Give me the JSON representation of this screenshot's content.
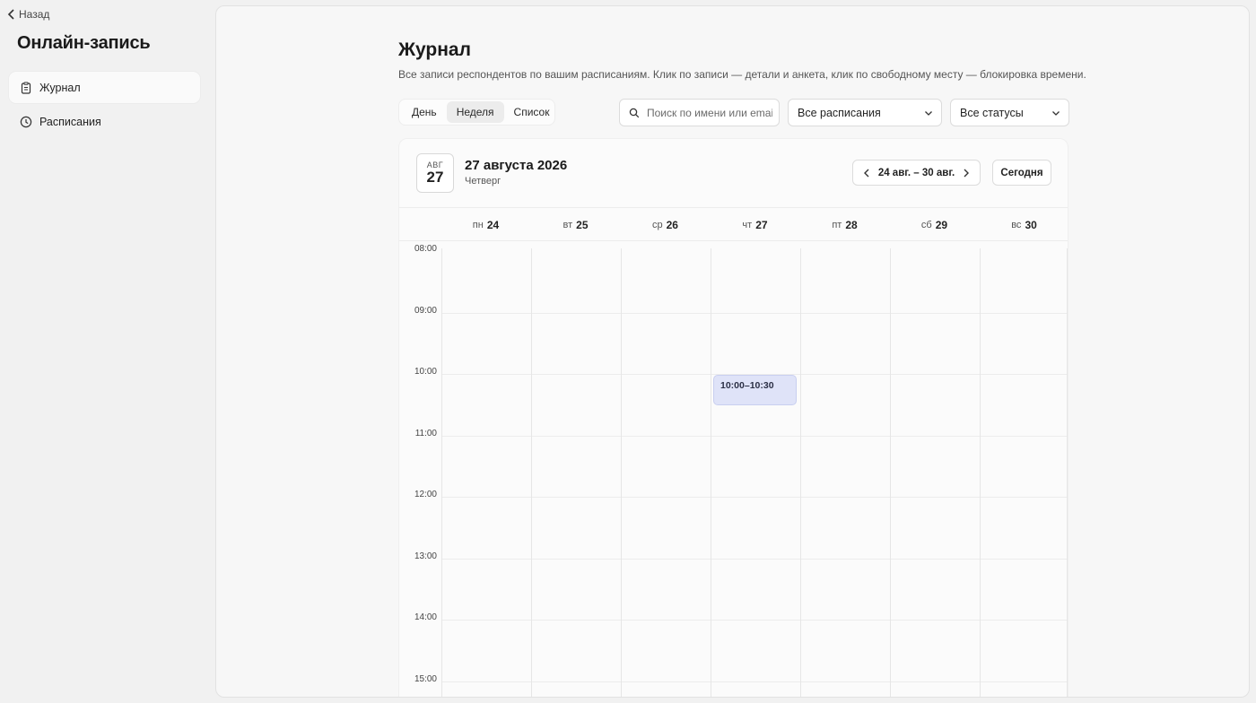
{
  "sidebar": {
    "back_label": "Назад",
    "app_title": "Онлайн-запись",
    "items": [
      {
        "label": "Журнал",
        "icon": "clipboard-icon",
        "active": true
      },
      {
        "label": "Расписания",
        "icon": "clock-icon",
        "active": false
      }
    ]
  },
  "main": {
    "title": "Журнал",
    "description": "Все записи респондентов по вашим расписаниям. Клик по записи — детали и анкета, клик по свободному месту — блокировка времени.",
    "views": [
      "День",
      "Неделя",
      "Список"
    ],
    "active_view": "Неделя",
    "search": {
      "placeholder": "Поиск по имени или email",
      "value": ""
    },
    "schedule_filter": "Все расписания",
    "status_filter": "Все статусы"
  },
  "calendar": {
    "badge_month": "АВГ",
    "badge_day": "27",
    "date_title": "27 августа 2026",
    "weekday": "Четверг",
    "range_label": "24 авг. – 30 авг.",
    "today_label": "Сегодня",
    "days": [
      {
        "dow": "пн",
        "num": "24"
      },
      {
        "dow": "вт",
        "num": "25"
      },
      {
        "dow": "ср",
        "num": "26"
      },
      {
        "dow": "чт",
        "num": "27"
      },
      {
        "dow": "пт",
        "num": "28"
      },
      {
        "dow": "сб",
        "num": "29"
      },
      {
        "dow": "вс",
        "num": "30"
      }
    ],
    "hours": [
      "08:00",
      "09:00",
      "10:00",
      "11:00",
      "12:00",
      "13:00",
      "14:00",
      "15:00"
    ],
    "events": [
      {
        "label": "10:00–10:30",
        "day_index": 3,
        "start_hour": 10.0,
        "end_hour": 10.5
      }
    ],
    "event_color": "#dfe3f8"
  }
}
